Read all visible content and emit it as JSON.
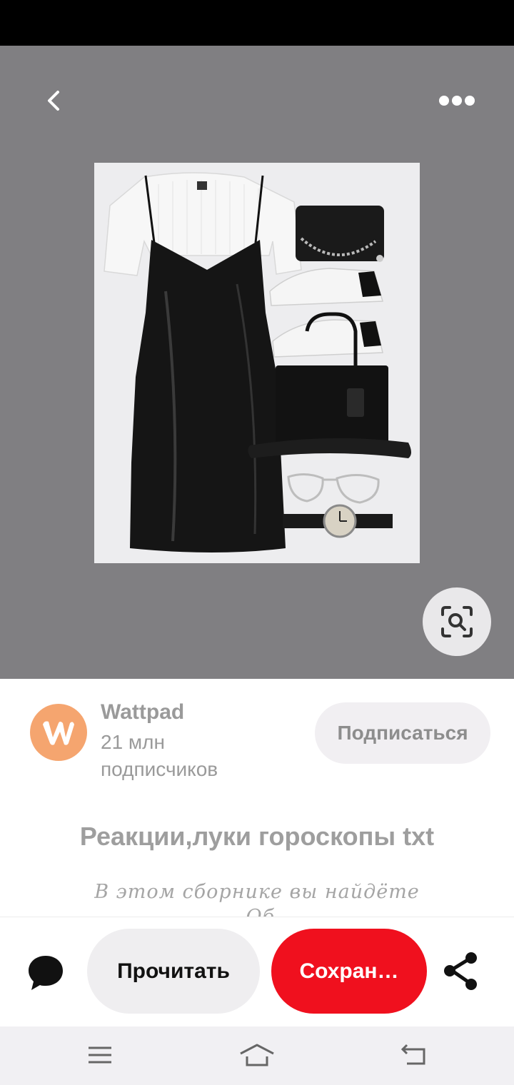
{
  "colors": {
    "hero_background": "#807f82",
    "save_button": "#f0101e",
    "avatar": "#f5a56f"
  },
  "header": {
    "back_icon": "chevron-left-icon",
    "more_icon": "more-horizontal-icon"
  },
  "pin": {
    "image_alt": "outfit collage",
    "lens_icon": "visual-search-icon",
    "title": "Реакции,луки гороскопы txt",
    "description_line1": "В этом сборнике вы найдёте",
    "description_line2": "… Об…"
  },
  "creator": {
    "name": "Wattpad",
    "followers": "21 млн подписчиков",
    "avatar_icon": "wattpad-logo-icon",
    "subscribe_label": "Подписаться"
  },
  "actions": {
    "comment_icon": "comment-icon",
    "read_label": "Прочитать",
    "save_label": "Сохран…",
    "share_icon": "share-icon"
  },
  "nav": {
    "menu_icon": "menu-icon",
    "home_icon": "home-icon",
    "back_icon": "back-arrow-icon"
  }
}
